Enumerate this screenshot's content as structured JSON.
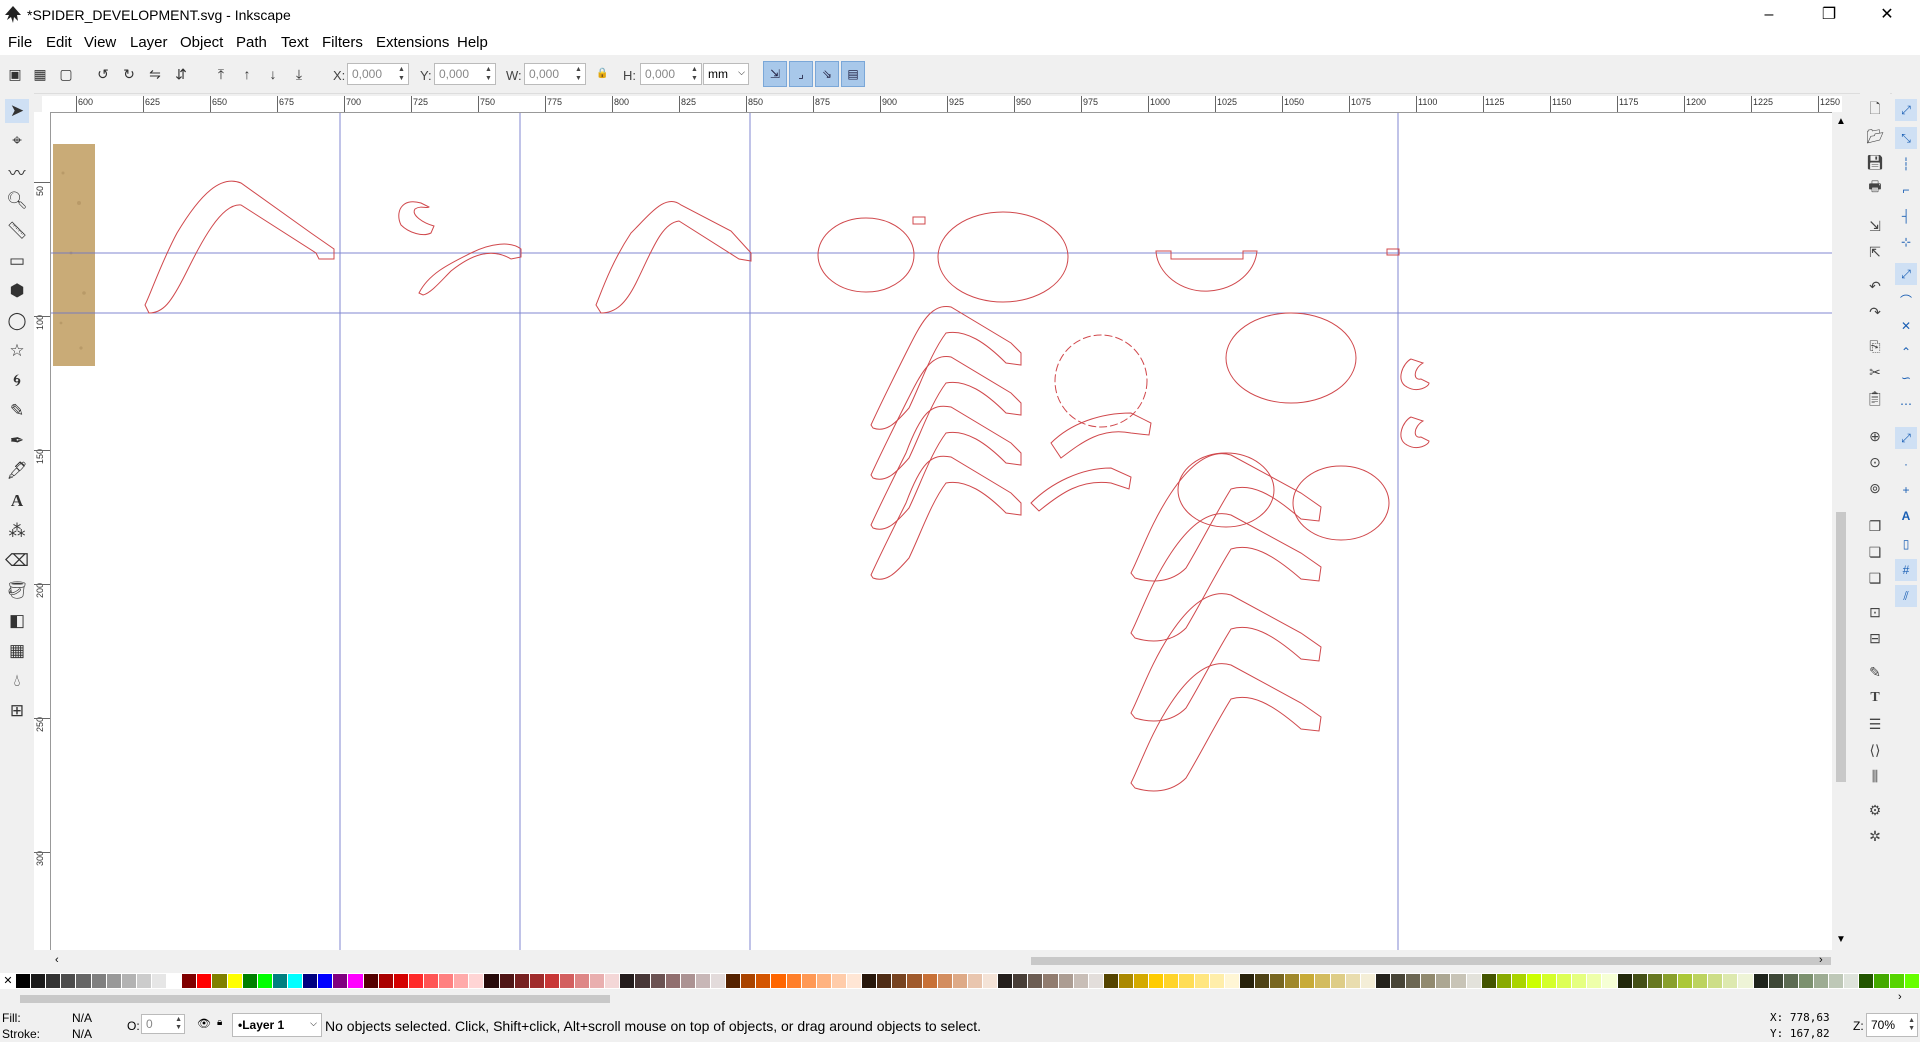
{
  "window": {
    "title": "*SPIDER_DEVELOPMENT.svg - Inkscape",
    "minimize": "–",
    "restore": "❐",
    "close": "✕"
  },
  "menu": [
    "File",
    "Edit",
    "View",
    "Layer",
    "Object",
    "Path",
    "Text",
    "Filters",
    "Extensions",
    "Help"
  ],
  "controls": {
    "x_label": "X:",
    "x_value": "0,000",
    "y_label": "Y:",
    "y_value": "0,000",
    "w_label": "W:",
    "w_value": "0,000",
    "lock_glyph": "🔒",
    "h_label": "H:",
    "h_value": "0,000",
    "unit": "mm"
  },
  "ruler": {
    "h_ticks": [
      "600",
      "625",
      "650",
      "675",
      "700",
      "725",
      "750",
      "775",
      "800",
      "825",
      "850",
      "875",
      "900",
      "925",
      "950",
      "975",
      "1000",
      "1025",
      "1050",
      "1075",
      "1100",
      "1125",
      "1150",
      "1175",
      "1200",
      "1225",
      "1250"
    ],
    "v_ticks": [
      "50",
      "100",
      "150",
      "200",
      "250",
      "300"
    ]
  },
  "status": {
    "fill_label": "Fill:",
    "fill_value": "N/A",
    "stroke_label": "Stroke:",
    "stroke_value": "N/A",
    "opacity_label": "O:",
    "opacity_value": "0",
    "layer": "•Layer 1",
    "message": "No objects selected. Click, Shift+click, Alt+scroll mouse on top of objects, or drag around objects to select.",
    "x_readout": "X: 778,63",
    "y_readout": "Y: 167,82",
    "zoom_label": "Z:",
    "zoom": "70%"
  },
  "palette_colors": [
    "#000000",
    "#1a1a1a",
    "#333333",
    "#4d4d4d",
    "#666666",
    "#808080",
    "#999999",
    "#b3b3b3",
    "#cccccc",
    "#e6e6e6",
    "#ffffff",
    "#800000",
    "#ff0000",
    "#808000",
    "#ffff00",
    "#008000",
    "#00ff00",
    "#008080",
    "#00ffff",
    "#000080",
    "#0000ff",
    "#800080",
    "#ff00ff",
    "#550000",
    "#aa0000",
    "#d40000",
    "#ff2a2a",
    "#ff5555",
    "#ff8080",
    "#ffaaaa",
    "#ffd5d5",
    "#280b0b",
    "#501616",
    "#782121",
    "#a02c2c",
    "#c83737",
    "#d35f5f",
    "#de8787",
    "#e9afaf",
    "#f4d7d7",
    "#241c1c",
    "#483737",
    "#6c5353",
    "#916f6f",
    "#ac9393",
    "#c8b7b7",
    "#e3dbdb",
    "#552200",
    "#aa4400",
    "#d45500",
    "#ff6600",
    "#ff7f2a",
    "#ff9955",
    "#ffb380",
    "#ffccaa",
    "#ffe6d5",
    "#28170b",
    "#502d16",
    "#784421",
    "#a05a2c",
    "#c87137",
    "#d38d5f",
    "#deaa87",
    "#e9c6af",
    "#f4e3d7",
    "#241f1c",
    "#483e37",
    "#6c5d53",
    "#917c6f",
    "#ac9d93",
    "#c8beb7",
    "#e3dedb",
    "#554400",
    "#aa8800",
    "#d4aa00",
    "#ffcc00",
    "#ffd42a",
    "#ffdd55",
    "#ffe680",
    "#ffeeaa",
    "#fff6d5",
    "#28220b",
    "#504416",
    "#786721",
    "#a0892c",
    "#c8ab37",
    "#d3bc5f",
    "#decd87",
    "#e9ddaf",
    "#f4eed7",
    "#24221c",
    "#484537",
    "#6c6753",
    "#918a6f",
    "#aca793",
    "#c8c4b7",
    "#e3e2db",
    "#445500",
    "#88aa00",
    "#aad400",
    "#ccff00",
    "#d4ff2a",
    "#ddff55",
    "#e5ff80",
    "#eeffaa",
    "#f6ffd5",
    "#22280b",
    "#445016",
    "#677821",
    "#89a02c",
    "#abc837",
    "#bcd35f",
    "#cdde87",
    "#dde9af",
    "#eef4d7",
    "#1f241c",
    "#3e4837",
    "#5d6c53",
    "#7c916f",
    "#9dac93",
    "#bec8b7",
    "#dee3db",
    "#225500",
    "#44aa00",
    "#55d400",
    "#66ff00"
  ],
  "toolbox": [
    "selector-tool",
    "node-tool",
    "tweak-tool",
    "zoom-tool",
    "measure-tool",
    "rect-tool",
    "3dbox-tool",
    "ellipse-tool",
    "star-tool",
    "spiral-tool",
    "pencil-tool",
    "pen-tool",
    "calligraphy-tool",
    "text-tool",
    "spray-tool",
    "eraser-tool",
    "bucket-tool",
    "gradient-tool",
    "mesh-tool",
    "dropper-tool",
    "connector-tool"
  ]
}
